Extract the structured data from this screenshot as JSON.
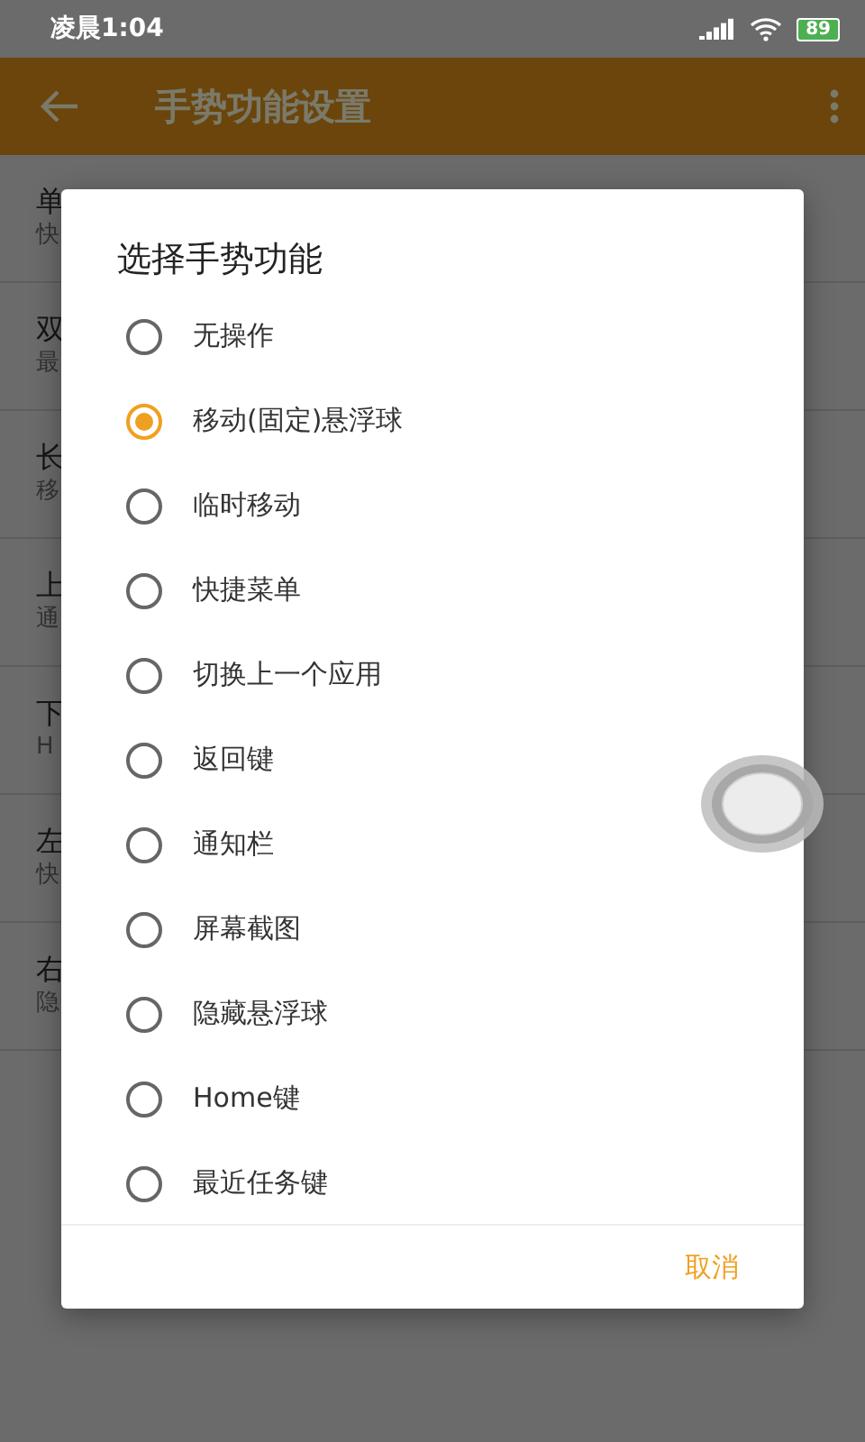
{
  "status_bar": {
    "time": "凌晨1:04",
    "battery": "89"
  },
  "toolbar": {
    "title": "手势功能设置"
  },
  "settings": [
    {
      "title": "单",
      "subtitle": "快"
    },
    {
      "title": "双",
      "subtitle": "最"
    },
    {
      "title": "长",
      "subtitle": "移"
    },
    {
      "title": "上",
      "subtitle": "通"
    },
    {
      "title": "下",
      "subtitle": "H"
    },
    {
      "title": "左",
      "subtitle": "快"
    },
    {
      "title": "右",
      "subtitle": "隐"
    }
  ],
  "dialog": {
    "title": "选择手势功能",
    "options": [
      {
        "label": "无操作",
        "selected": false
      },
      {
        "label": "移动(固定)悬浮球",
        "selected": true
      },
      {
        "label": "临时移动",
        "selected": false
      },
      {
        "label": "快捷菜单",
        "selected": false
      },
      {
        "label": "切换上一个应用",
        "selected": false
      },
      {
        "label": "返回键",
        "selected": false
      },
      {
        "label": "通知栏",
        "selected": false
      },
      {
        "label": "屏幕截图",
        "selected": false
      },
      {
        "label": "隐藏悬浮球",
        "selected": false
      },
      {
        "label": "Home键",
        "selected": false
      },
      {
        "label": "最近任务键",
        "selected": false
      }
    ],
    "cancel": "取消"
  }
}
